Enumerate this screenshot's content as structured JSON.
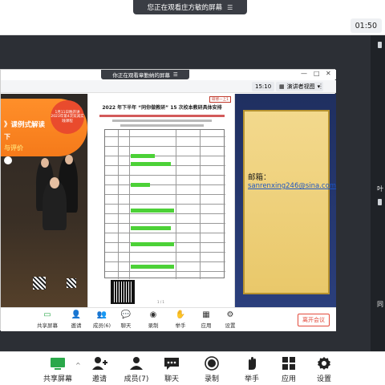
{
  "outer": {
    "banner_text": "您正在观看庄方敏的屏幕",
    "time": "01:50"
  },
  "inner": {
    "banner_text": "你正在观看章勤纳的屏幕",
    "time": "15:10",
    "view_label": "演讲者视图",
    "leave_label": "离开会议"
  },
  "poster": {
    "title": "课例式解读",
    "title_left": "》",
    "line1": "下",
    "line2": "与评价",
    "badge": "1月11日晚开讲 2023年第4次双减实践课程"
  },
  "doc": {
    "title": "2022 年下半年 “同你做教研” 15 次校本教研具体安排",
    "badge": "研修一上1",
    "page": "1 / 1"
  },
  "slide": {
    "email_label": "邮箱：",
    "email": "sanrenxing246@sina.com"
  },
  "inner_toolbar": [
    {
      "label": "共享屏幕",
      "icon": "share-screen-icon"
    },
    {
      "label": "邀请",
      "icon": "invite-icon"
    },
    {
      "label": "成员(6)",
      "icon": "members-icon"
    },
    {
      "label": "聊天",
      "icon": "chat-icon"
    },
    {
      "label": "录制",
      "icon": "record-icon"
    },
    {
      "label": "举手",
      "icon": "raise-hand-icon"
    },
    {
      "label": "应用",
      "icon": "apps-icon"
    },
    {
      "label": "设置",
      "icon": "settings-icon"
    }
  ],
  "outer_toolbar": [
    {
      "label": "共享屏幕",
      "icon": "share-screen-icon"
    },
    {
      "label": "邀请",
      "icon": "invite-icon"
    },
    {
      "label": "成员(7)",
      "icon": "members-icon"
    },
    {
      "label": "聊天",
      "icon": "chat-icon"
    },
    {
      "label": "录制",
      "icon": "record-icon"
    },
    {
      "label": "举手",
      "icon": "raise-hand-icon"
    },
    {
      "label": "应用",
      "icon": "apps-icon"
    },
    {
      "label": "设置",
      "icon": "settings-icon"
    }
  ],
  "right_strip": [
    "叶",
    "同"
  ],
  "colors": {
    "accent": "#2aa84a",
    "leave": "#e24a3b",
    "poster_orange": "#f57a1a",
    "slide_blue": "#2b3f7c"
  }
}
